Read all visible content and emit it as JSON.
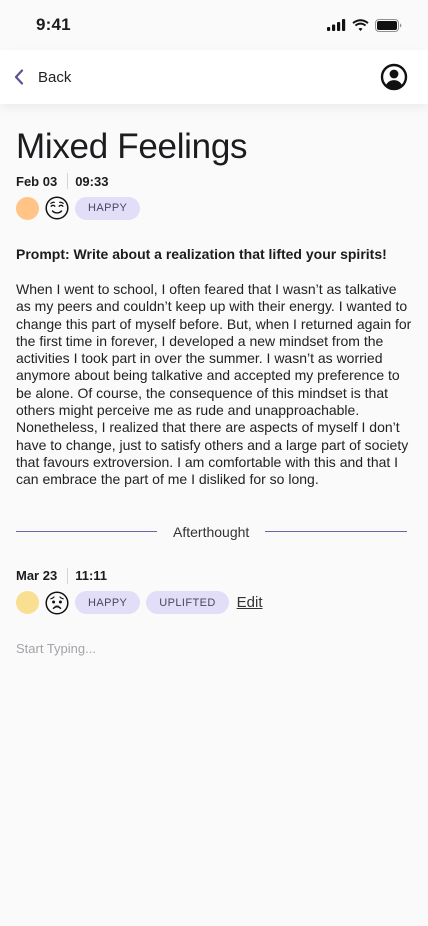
{
  "status_bar": {
    "time": "9:41"
  },
  "nav": {
    "back_label": "Back"
  },
  "entry": {
    "title": "Mixed Feelings",
    "date": "Feb 03",
    "time": "09:33",
    "mood_color": "#ffc486",
    "emoji": "relieved-face-icon",
    "tags": [
      "HAPPY"
    ],
    "prompt": "Prompt: Write about a realization that lifted your spirits!",
    "body": "When I went to school, I often feared that I wasn’t as talkative as my peers and couldn’t keep up with their energy. I wanted to change this part of myself before. But, when I returned again for the first time in forever, I developed a new mindset from the activities I took part in over the summer. I wasn’t as worried anymore about being talkative and accepted my preference to be alone. Of course, the consequence of this mindset is that others might perceive me as rude and unapproachable. Nonetheless, I realized that there are aspects of myself I don’t have to change, just to satisfy others and a large part of society that favours extroversion. I am comfortable with this and that I can embrace the part of me I disliked for so long."
  },
  "afterthought": {
    "label": "Afterthought",
    "date": "Mar 23",
    "time": "11:11",
    "mood_color": "#f9df92",
    "emoji": "worried-face-icon",
    "tags": [
      "HAPPY",
      "UPLIFTED"
    ],
    "edit_label": "Edit",
    "input_placeholder": "Start Typing..."
  },
  "colors": {
    "accent": "#6b66a3",
    "tag_bg": "#e2def7",
    "background": "#fafafb"
  }
}
